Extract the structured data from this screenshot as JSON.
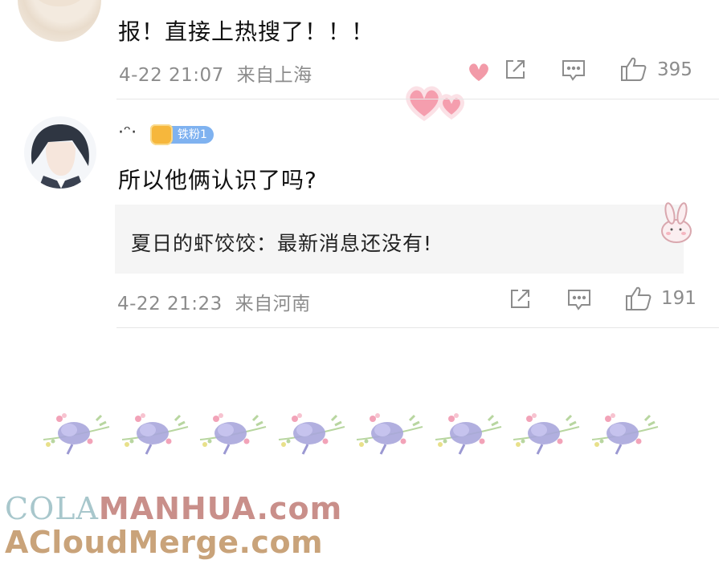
{
  "comments": [
    {
      "text": "报！直接上热搜了！！！",
      "time": "4-22 21:07",
      "location": "来自上海",
      "likes": "395"
    },
    {
      "username": "·ᵔ·",
      "badge": "铁粉1",
      "text": "所以他俩认识了吗?",
      "reply_author": "夏日的虾饺饺：",
      "reply_text": "最新消息还没有!",
      "time": "4-22 21:23",
      "location": "来自河南",
      "likes": "191"
    }
  ],
  "watermark": {
    "line1_a": "COLA",
    "line1_b": "MANHUA.com",
    "line2": "ACloudMerge.com"
  },
  "colors": {
    "meta_gray": "#8c8c8c",
    "badge_blue": "#7fb2f0",
    "crown_gold": "#f6b73c",
    "watermark_teal": "#a8c7cc",
    "watermark_rose": "#c98f8a",
    "watermark_tan": "#c9a37a"
  },
  "icons": [
    "share-icon",
    "comment-icon",
    "like-icon",
    "heart-sticker-icon",
    "bunny-sticker-icon",
    "flower-divider-icon"
  ]
}
